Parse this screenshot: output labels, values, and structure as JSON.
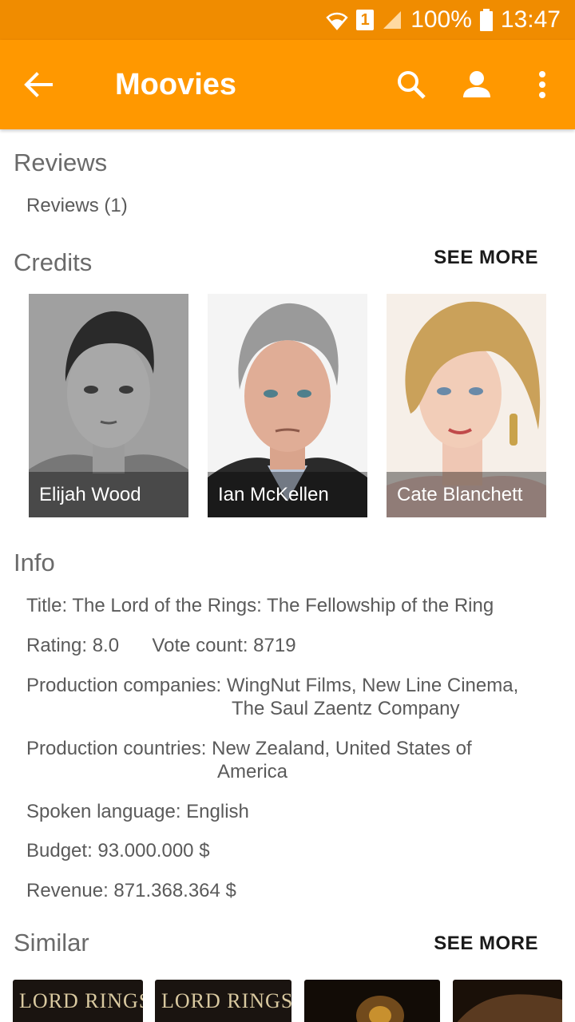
{
  "status_bar": {
    "battery": "100%",
    "time": "13:47",
    "sim": "1"
  },
  "app_bar": {
    "title": "Moovies"
  },
  "reviews": {
    "title": "Reviews",
    "link": "Reviews (1)"
  },
  "credits": {
    "title": "Credits",
    "see_more": "SEE MORE",
    "people": [
      {
        "name": "Elijah Wood"
      },
      {
        "name": "Ian McKellen"
      },
      {
        "name": "Cate Blanchett"
      }
    ]
  },
  "info": {
    "title": "Info",
    "movie_title": "Title: The Lord of the Rings: The Fellowship of the Ring",
    "rating": "Rating: 8.0",
    "vote_count": "Vote count: 8719",
    "companies_label": "Production companies: ",
    "companies_line1": "WingNut Films, New Line Cinema,",
    "companies_line2": "The Saul Zaentz Company",
    "countries_label": "Production countries: ",
    "countries_line1": "New Zealand, United States of",
    "countries_line2": "America",
    "language": "Spoken language: English",
    "budget": "Budget: 93.000.000 $",
    "revenue": "Revenue: 871.368.364 $"
  },
  "similar": {
    "title": "Similar",
    "see_more": "SEE MORE",
    "posters": [
      {
        "text": "LORD RINGS"
      },
      {
        "text": "LORD RINGS"
      },
      {
        "text": ""
      },
      {
        "text": ""
      }
    ]
  },
  "colors": {
    "status_bar": "#f08c00",
    "app_bar": "#ff9800"
  }
}
